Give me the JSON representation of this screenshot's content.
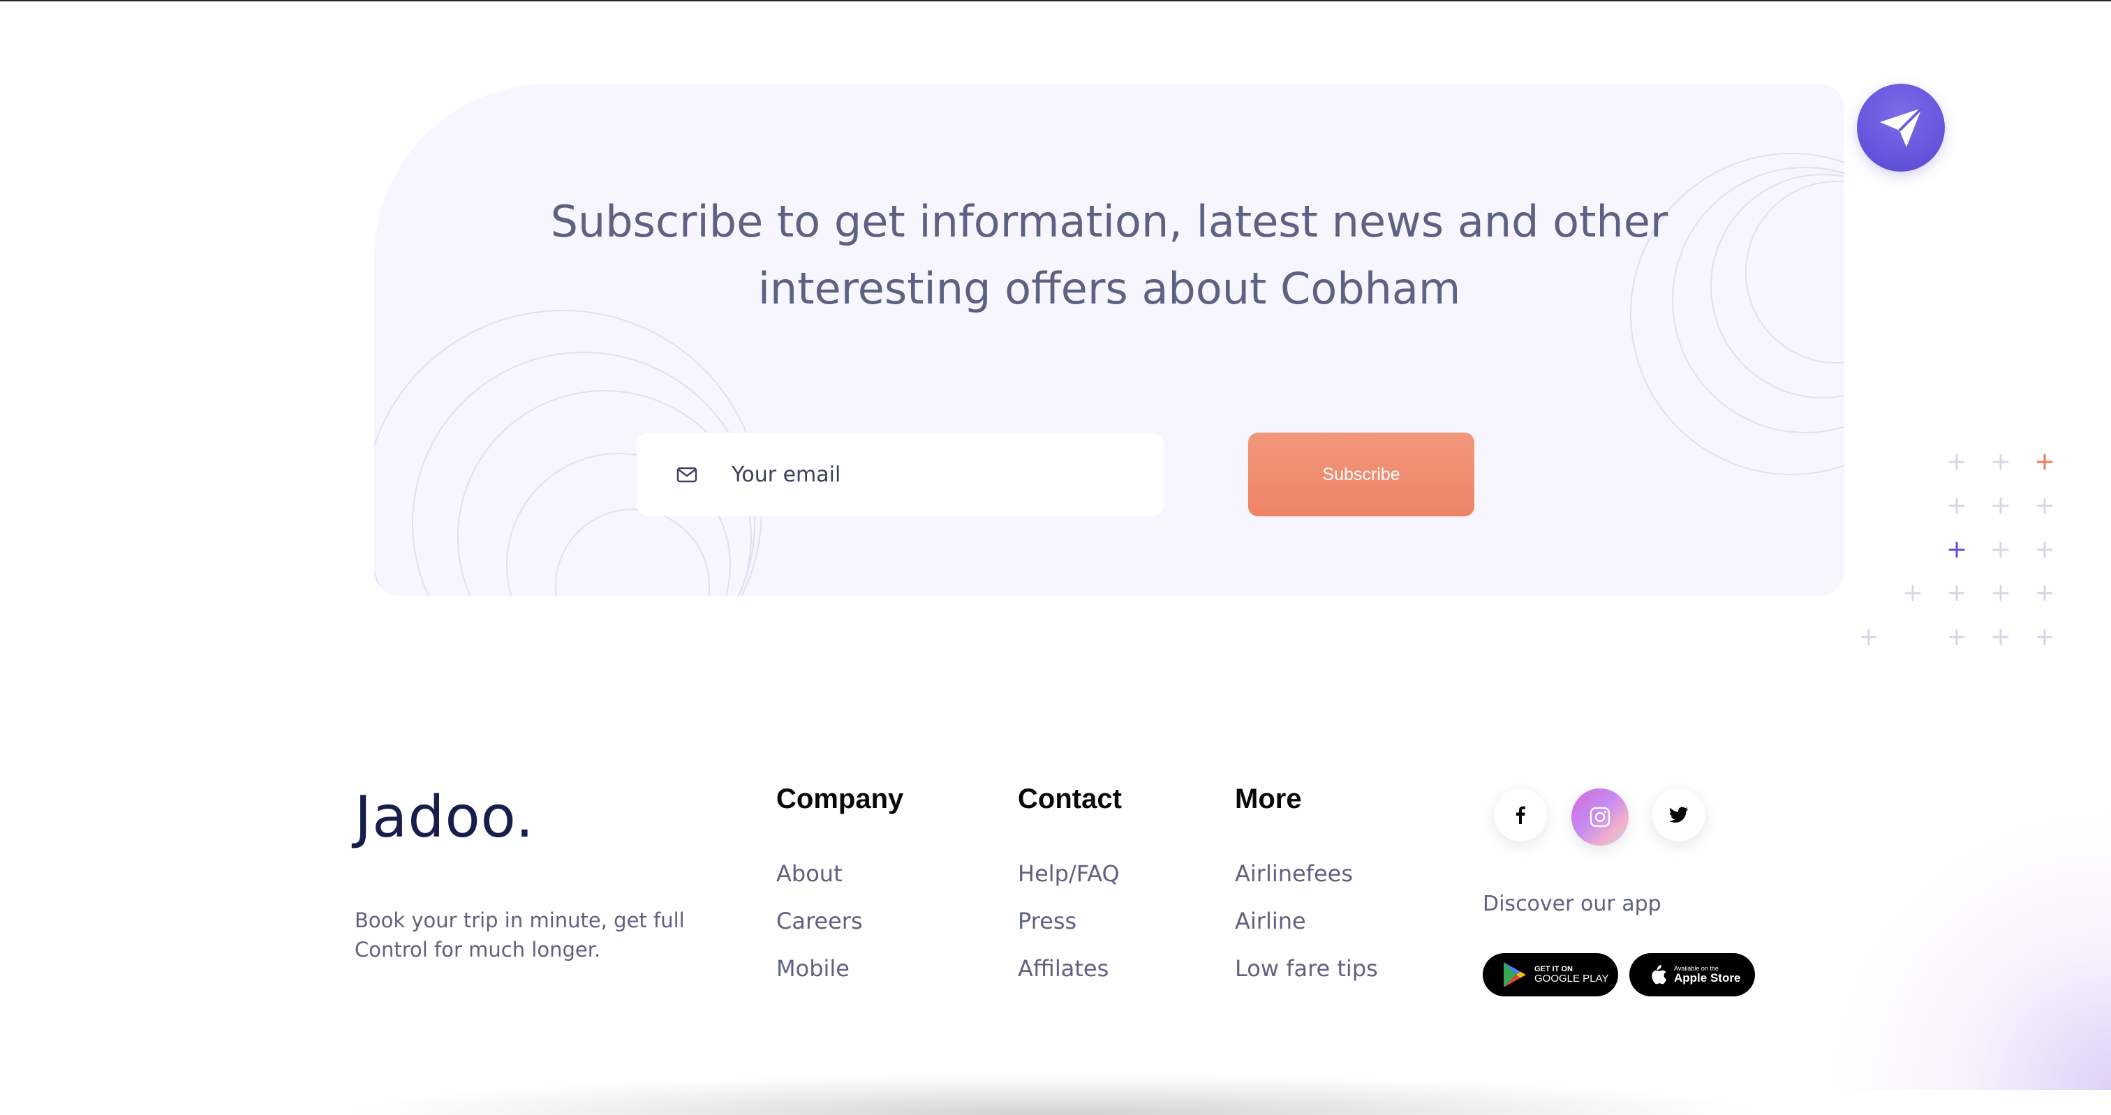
{
  "subscribe": {
    "title_line1": "Subscribe to get information, latest news and other",
    "title_line2": "interesting offers about Cobham",
    "email_placeholder": "Your email",
    "email_value": "",
    "button_label": "Subscribe",
    "email_icon": "envelope-icon",
    "badge_icon": "send-icon"
  },
  "footer": {
    "brand": "Jadoo.",
    "tagline": "Book your trip in minute, get full Control for much longer.",
    "columns": [
      {
        "heading": "Company",
        "links": [
          "About",
          "Careers",
          "Mobile"
        ]
      },
      {
        "heading": "Contact",
        "links": [
          "Help/FAQ",
          "Press",
          "Affilates"
        ]
      },
      {
        "heading": "More",
        "links": [
          "Airlinefees",
          "Airline",
          "Low fare tips"
        ]
      }
    ],
    "social": [
      "facebook-icon",
      "instagram-icon",
      "twitter-icon"
    ],
    "discover_label": "Discover our app",
    "google_badge": {
      "small": "GET IT ON",
      "big": "GOOGLE PLAY"
    },
    "apple_badge": {
      "small": "Available on the",
      "big": "Apple Store"
    }
  },
  "colors": {
    "card_bg": "#f7f5fd",
    "heading_text": "#5e6282",
    "brand_text": "#181e4b",
    "accent_orange": "#f0866a",
    "accent_purple": "#5f4fd9",
    "plus_orange": "#f07a57",
    "plus_purple": "#5f4fd9",
    "plus_grey": "#d9d5e6"
  }
}
